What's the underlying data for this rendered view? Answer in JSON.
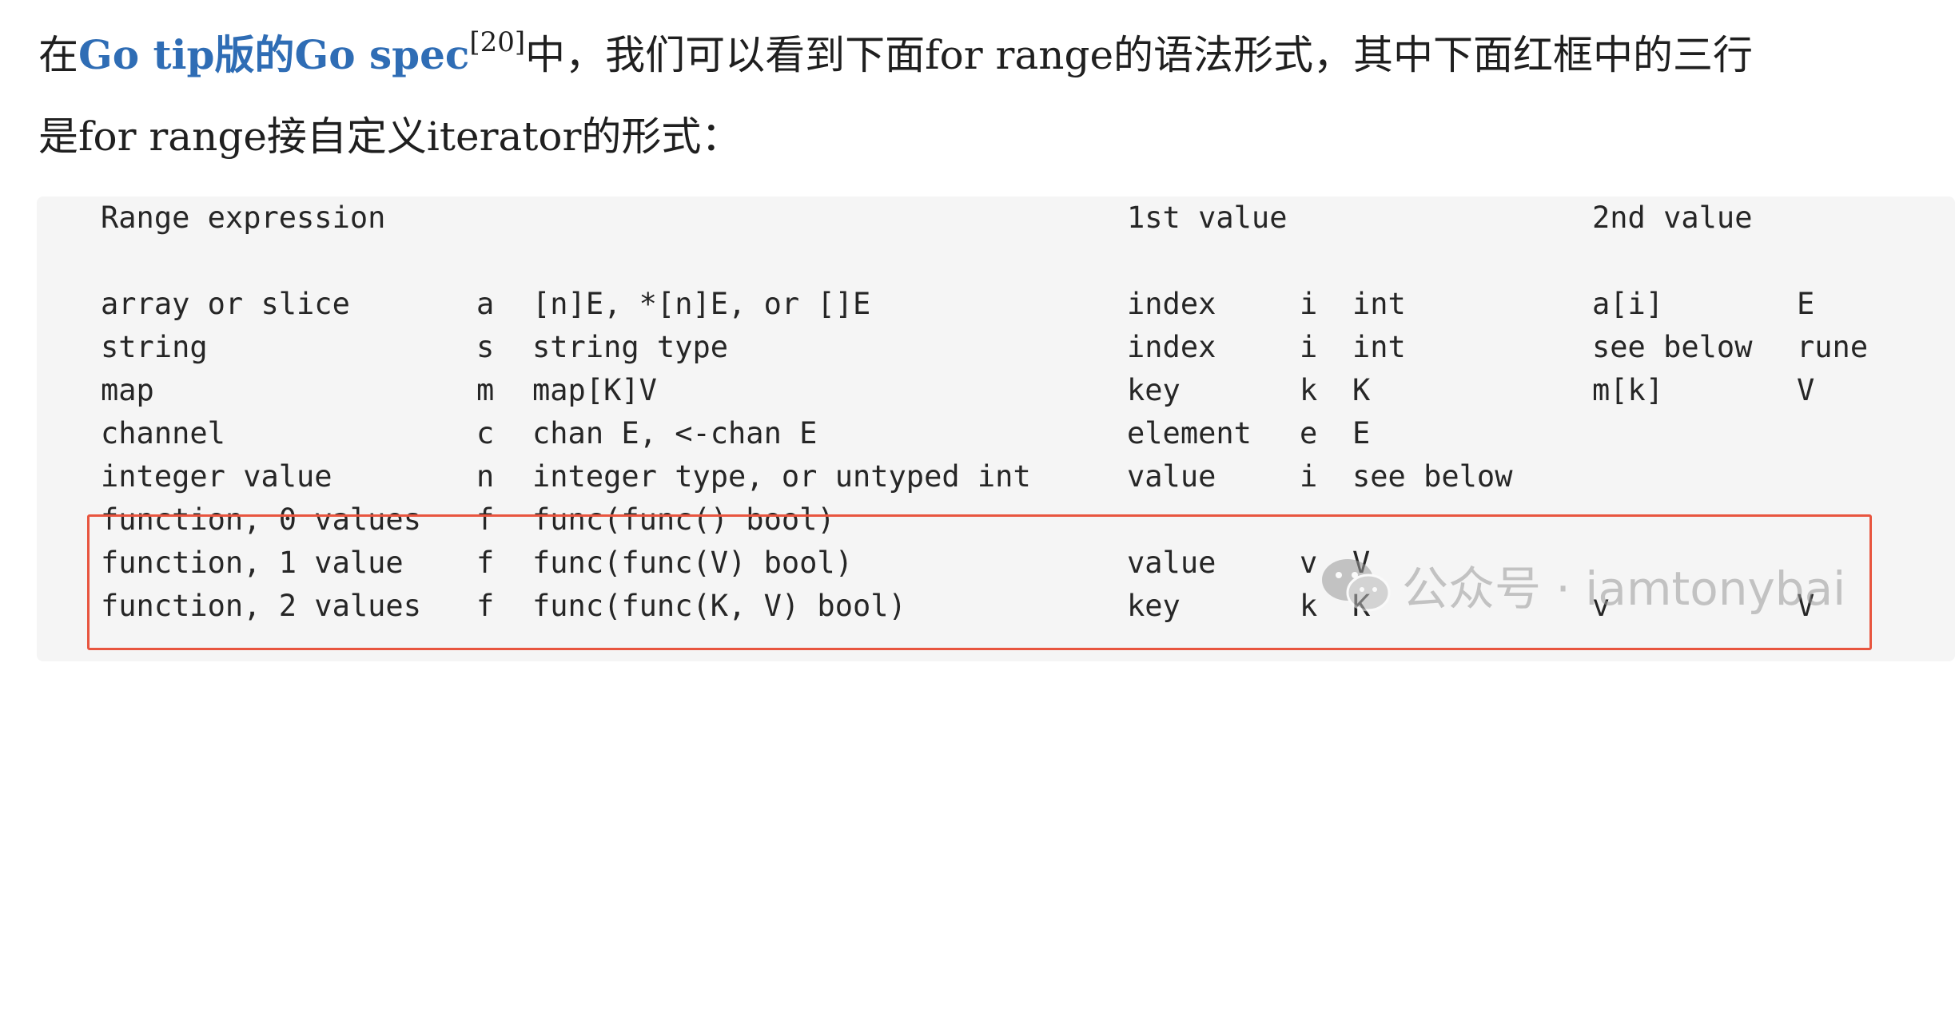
{
  "intro": {
    "prefix": "在",
    "link_text": "Go tip版的Go spec",
    "citation": "[20]",
    "suffix_line1": "中，我们可以看到下面for range的语法形式，其中下面红框中的三行",
    "line2": "是for range接自定义iterator的形式："
  },
  "code": {
    "rows": [
      [
        "Range expression",
        "",
        "",
        "1st value",
        "",
        "",
        "2nd value",
        ""
      ],
      [
        "array or slice",
        "a",
        "[n]E, *[n]E, or []E",
        "index",
        "i",
        "int",
        "a[i]",
        "E"
      ],
      [
        "string",
        "s",
        "string type",
        "index",
        "i",
        "int",
        "see below",
        "rune"
      ],
      [
        "map",
        "m",
        "map[K]V",
        "key",
        "k",
        "K",
        "m[k]",
        "V"
      ],
      [
        "channel",
        "c",
        "chan E, <-chan E",
        "element",
        "e",
        "E",
        "",
        ""
      ],
      [
        "integer value",
        "n",
        "integer type, or untyped int",
        "value",
        "i",
        "see below",
        "",
        ""
      ],
      [
        "function, 0 values",
        "f",
        "func(func() bool)",
        "",
        "",
        "",
        "",
        ""
      ],
      [
        "function, 1 value",
        "f",
        "func(func(V) bool)",
        "value",
        "v",
        "V",
        "",
        ""
      ],
      [
        "function, 2 values",
        "f",
        "func(func(K, V) bool)",
        "key",
        "k",
        "K",
        "v",
        "V"
      ]
    ]
  },
  "watermark": {
    "text": "公众号 · iamtonybai",
    "icon": "wechat-icon"
  },
  "colors": {
    "link": "#2f6db5",
    "highlight_border": "#e8553f",
    "code_background": "#f5f5f5"
  }
}
